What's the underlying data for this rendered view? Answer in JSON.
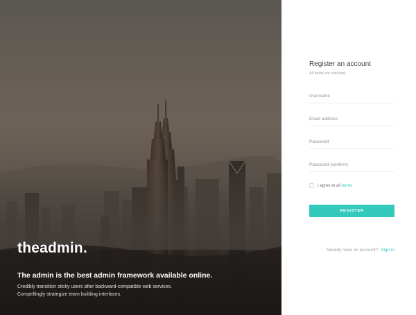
{
  "hero": {
    "brand": "theadmin.",
    "tagline": "The admin is the best admin framework available online.",
    "blurb": "Credibly transition sticky users after backward-compatible web services. Compellingly strategize team building interfaces."
  },
  "form": {
    "title": "Register an account",
    "note": "All fields are required.",
    "fields": {
      "username": {
        "placeholder": "Username",
        "value": ""
      },
      "email": {
        "placeholder": "Email address",
        "value": ""
      },
      "password": {
        "placeholder": "Password",
        "value": ""
      },
      "password_confirm": {
        "placeholder": "Password (confirm)",
        "value": ""
      }
    },
    "agree": {
      "checked": false,
      "label": "I agree to all",
      "link": "terms"
    },
    "submit_label": "REGISTER",
    "signin": {
      "prompt": "Already have an account?",
      "link": "Sign in"
    }
  },
  "colors": {
    "accent": "#33cabb",
    "text_dark": "#3a3f45",
    "text_muted": "#9aa0a6",
    "hero_overlay": "#5f5850"
  }
}
